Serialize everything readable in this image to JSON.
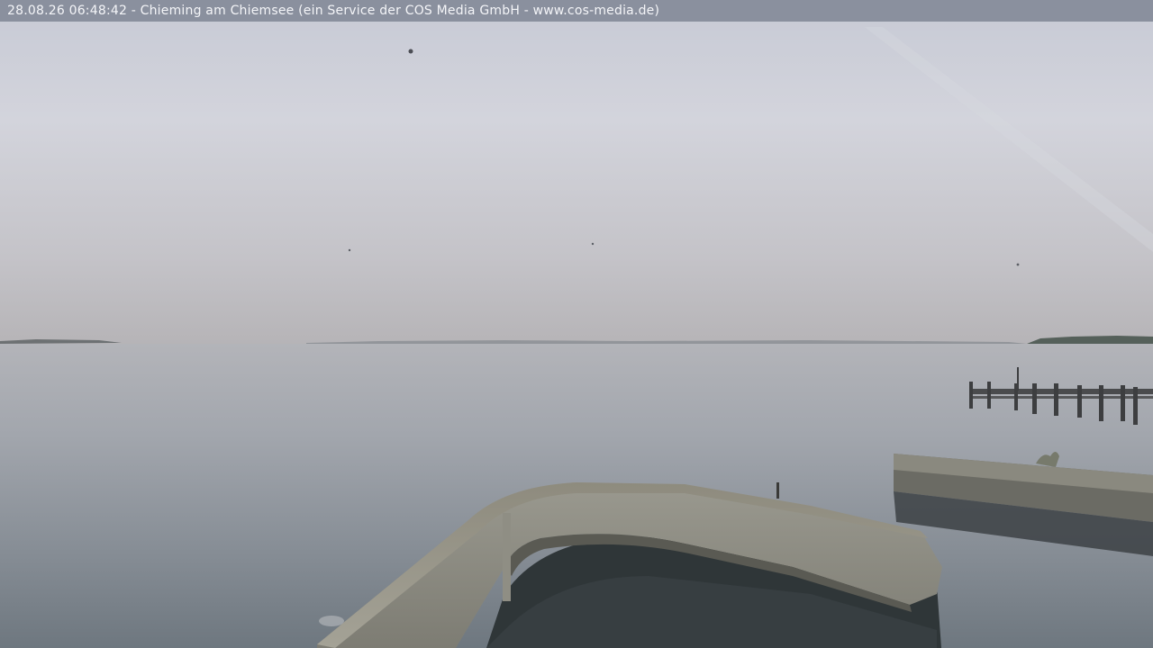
{
  "overlay": {
    "caption": "28.08.26 06:48:42 - Chieming am Chiemsee (ein Service der COS Media GmbH - www.cos-media.de)"
  },
  "colors": {
    "sky_top": "#c9ccd6",
    "sky_horizon": "#b8b6b8",
    "water_top": "#aeb1b7",
    "water_bottom": "#6f7880",
    "stone_wall": "#8c8c83",
    "caption_bar": "#7d8291"
  }
}
